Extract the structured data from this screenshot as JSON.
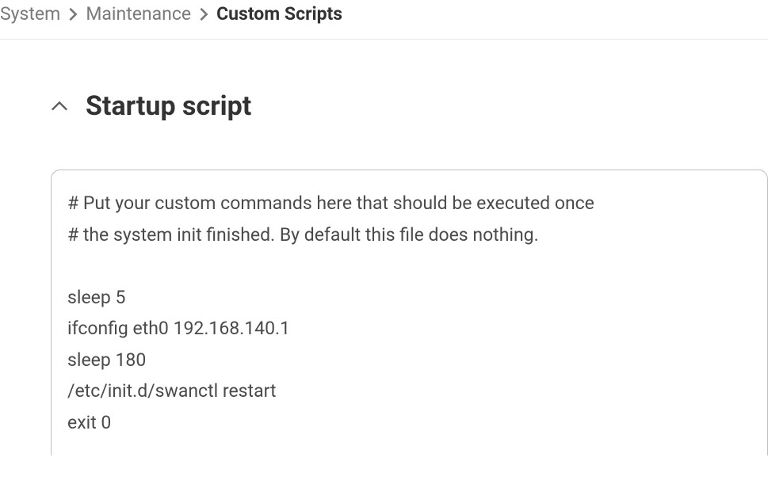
{
  "breadcrumb": {
    "items": [
      {
        "label": "System",
        "current": false
      },
      {
        "label": "Maintenance",
        "current": false
      },
      {
        "label": "Custom Scripts",
        "current": true
      }
    ]
  },
  "section": {
    "title": "Startup script",
    "script": "# Put your custom commands here that should be executed once\n# the system init finished. By default this file does nothing.\n\nsleep 5\nifconfig eth0 192.168.140.1\nsleep 180\n/etc/init.d/swanctl restart\nexit 0"
  }
}
